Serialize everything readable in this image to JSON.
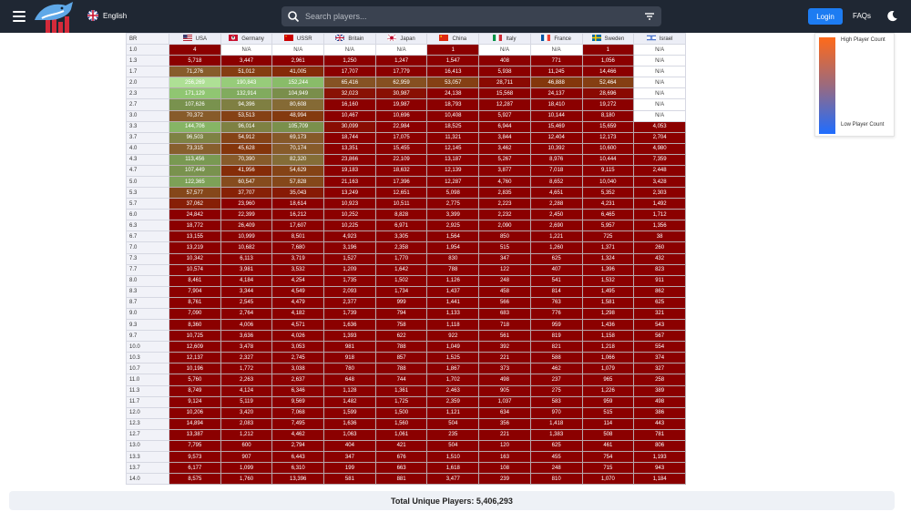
{
  "header": {
    "language": "English",
    "search_placeholder": "Search players...",
    "login_label": "Login",
    "faqs_label": "FAQs",
    "menu_icon": "hamburger-menu-icon",
    "search_icon": "search-icon",
    "filter_icon": "filter-icon",
    "theme_icon": "moon-icon"
  },
  "legend": {
    "high_label": "High Player Count",
    "low_label": "Low Player Count",
    "high_color": "#ff6a1a",
    "low_color": "#1f6dff"
  },
  "table": {
    "br_header": "BR",
    "nations": [
      {
        "name": "USA",
        "flag": "us"
      },
      {
        "name": "Germany",
        "flag": "de"
      },
      {
        "name": "USSR",
        "flag": "su"
      },
      {
        "name": "Britain",
        "flag": "gb"
      },
      {
        "name": "Japan",
        "flag": "jp"
      },
      {
        "name": "China",
        "flag": "cn"
      },
      {
        "name": "Italy",
        "flag": "it"
      },
      {
        "name": "France",
        "flag": "fr"
      },
      {
        "name": "Sweden",
        "flag": "se"
      },
      {
        "name": "Israel",
        "flag": "il"
      }
    ],
    "rows": [
      {
        "br": "1.0",
        "v": [
          "4",
          "N/A",
          "N/A",
          "N/A",
          "N/A",
          "1",
          "N/A",
          "N/A",
          "1",
          "N/A"
        ]
      },
      {
        "br": "1.3",
        "v": [
          "5,718",
          "3,447",
          "2,961",
          "1,250",
          "1,247",
          "1,547",
          "408",
          "771",
          "1,056",
          "N/A"
        ]
      },
      {
        "br": "1.7",
        "v": [
          "71,276",
          "51,012",
          "41,005",
          "17,707",
          "17,779",
          "16,413",
          "5,938",
          "11,245",
          "14,466",
          "N/A"
        ]
      },
      {
        "br": "2.0",
        "v": [
          "256,269",
          "190,843",
          "152,244",
          "65,416",
          "62,959",
          "53,057",
          "28,711",
          "46,888",
          "52,464",
          "N/A"
        ]
      },
      {
        "br": "2.3",
        "v": [
          "171,129",
          "132,914",
          "104,949",
          "32,023",
          "30,987",
          "24,138",
          "15,568",
          "24,137",
          "28,696",
          "N/A"
        ]
      },
      {
        "br": "2.7",
        "v": [
          "107,626",
          "94,396",
          "80,608",
          "16,160",
          "19,987",
          "18,793",
          "12,287",
          "18,410",
          "19,272",
          "N/A"
        ]
      },
      {
        "br": "3.0",
        "v": [
          "70,372",
          "53,513",
          "48,994",
          "10,467",
          "10,696",
          "10,408",
          "5,927",
          "10,144",
          "8,180",
          "N/A"
        ]
      },
      {
        "br": "3.3",
        "v": [
          "144,706",
          "96,014",
          "105,709",
          "30,099",
          "22,984",
          "18,525",
          "6,944",
          "15,469",
          "15,659",
          "4,053"
        ]
      },
      {
        "br": "3.7",
        "v": [
          "96,503",
          "54,912",
          "69,173",
          "18,744",
          "17,075",
          "11,321",
          "3,844",
          "12,404",
          "12,173",
          "2,704"
        ]
      },
      {
        "br": "4.0",
        "v": [
          "73,315",
          "45,628",
          "70,174",
          "13,351",
          "15,455",
          "12,145",
          "3,462",
          "10,392",
          "10,600",
          "4,980"
        ]
      },
      {
        "br": "4.3",
        "v": [
          "113,456",
          "70,390",
          "82,320",
          "23,866",
          "22,109",
          "13,187",
          "5,267",
          "8,976",
          "10,444",
          "7,359"
        ]
      },
      {
        "br": "4.7",
        "v": [
          "107,449",
          "41,956",
          "54,629",
          "19,183",
          "18,632",
          "12,139",
          "3,877",
          "7,018",
          "9,115",
          "2,448"
        ]
      },
      {
        "br": "5.0",
        "v": [
          "122,365",
          "60,547",
          "57,828",
          "21,163",
          "17,396",
          "12,287",
          "4,760",
          "8,652",
          "10,040",
          "3,428"
        ]
      },
      {
        "br": "5.3",
        "v": [
          "57,577",
          "37,707",
          "35,043",
          "13,249",
          "12,651",
          "5,098",
          "2,835",
          "4,651",
          "5,352",
          "2,303"
        ]
      },
      {
        "br": "5.7",
        "v": [
          "37,062",
          "23,960",
          "18,614",
          "10,923",
          "10,511",
          "2,775",
          "2,223",
          "2,288",
          "4,231",
          "1,492"
        ]
      },
      {
        "br": "6.0",
        "v": [
          "24,842",
          "22,399",
          "16,212",
          "10,252",
          "8,828",
          "3,399",
          "2,232",
          "2,450",
          "6,465",
          "1,712"
        ]
      },
      {
        "br": "6.3",
        "v": [
          "18,772",
          "26,409",
          "17,607",
          "10,225",
          "6,971",
          "2,925",
          "2,090",
          "2,690",
          "5,957",
          "1,356"
        ]
      },
      {
        "br": "6.7",
        "v": [
          "13,155",
          "10,999",
          "8,501",
          "4,923",
          "3,305",
          "1,564",
          "850",
          "1,221",
          "725",
          "38"
        ]
      },
      {
        "br": "7.0",
        "v": [
          "13,219",
          "10,682",
          "7,680",
          "3,196",
          "2,358",
          "1,954",
          "515",
          "1,260",
          "1,371",
          "260"
        ]
      },
      {
        "br": "7.3",
        "v": [
          "10,342",
          "6,113",
          "3,719",
          "1,527",
          "1,770",
          "830",
          "347",
          "625",
          "1,324",
          "432"
        ]
      },
      {
        "br": "7.7",
        "v": [
          "10,574",
          "3,981",
          "3,532",
          "1,209",
          "1,642",
          "788",
          "122",
          "407",
          "1,396",
          "823"
        ]
      },
      {
        "br": "8.0",
        "v": [
          "8,461",
          "4,184",
          "4,254",
          "1,735",
          "1,502",
          "1,126",
          "248",
          "541",
          "1,532",
          "911"
        ]
      },
      {
        "br": "8.3",
        "v": [
          "7,904",
          "3,344",
          "4,549",
          "2,093",
          "1,734",
          "1,437",
          "458",
          "814",
          "1,495",
          "862"
        ]
      },
      {
        "br": "8.7",
        "v": [
          "8,761",
          "2,545",
          "4,479",
          "2,377",
          "999",
          "1,441",
          "566",
          "763",
          "1,581",
          "625"
        ]
      },
      {
        "br": "9.0",
        "v": [
          "7,090",
          "2,764",
          "4,182",
          "1,739",
          "794",
          "1,133",
          "683",
          "776",
          "1,298",
          "321"
        ]
      },
      {
        "br": "9.3",
        "v": [
          "8,360",
          "4,006",
          "4,571",
          "1,636",
          "758",
          "1,118",
          "718",
          "959",
          "1,436",
          "543"
        ]
      },
      {
        "br": "9.7",
        "v": [
          "10,725",
          "3,636",
          "4,026",
          "1,393",
          "622",
          "922",
          "561",
          "819",
          "1,158",
          "567"
        ]
      },
      {
        "br": "10.0",
        "v": [
          "12,609",
          "3,478",
          "3,053",
          "981",
          "788",
          "1,049",
          "392",
          "821",
          "1,218",
          "554"
        ]
      },
      {
        "br": "10.3",
        "v": [
          "12,137",
          "2,327",
          "2,745",
          "918",
          "857",
          "1,525",
          "221",
          "588",
          "1,066",
          "374"
        ]
      },
      {
        "br": "10.7",
        "v": [
          "10,196",
          "1,772",
          "3,038",
          "780",
          "788",
          "1,867",
          "373",
          "462",
          "1,079",
          "327"
        ]
      },
      {
        "br": "11.0",
        "v": [
          "5,760",
          "2,263",
          "2,637",
          "648",
          "744",
          "1,702",
          "498",
          "237",
          "965",
          "258"
        ]
      },
      {
        "br": "11.3",
        "v": [
          "8,749",
          "4,124",
          "6,346",
          "1,128",
          "1,361",
          "2,463",
          "905",
          "275",
          "1,226",
          "389"
        ]
      },
      {
        "br": "11.7",
        "v": [
          "9,124",
          "5,119",
          "9,569",
          "1,482",
          "1,725",
          "2,359",
          "1,037",
          "583",
          "959",
          "498"
        ]
      },
      {
        "br": "12.0",
        "v": [
          "10,206",
          "3,420",
          "7,068",
          "1,599",
          "1,500",
          "1,121",
          "634",
          "970",
          "515",
          "386"
        ]
      },
      {
        "br": "12.3",
        "v": [
          "14,894",
          "2,083",
          "7,495",
          "1,636",
          "1,560",
          "504",
          "356",
          "1,418",
          "114",
          "443"
        ]
      },
      {
        "br": "12.7",
        "v": [
          "13,387",
          "1,212",
          "4,462",
          "1,063",
          "1,061",
          "235",
          "221",
          "1,383",
          "508",
          "781"
        ]
      },
      {
        "br": "13.0",
        "v": [
          "7,795",
          "600",
          "2,794",
          "404",
          "421",
          "504",
          "120",
          "625",
          "461",
          "806"
        ]
      },
      {
        "br": "13.3",
        "v": [
          "9,573",
          "907",
          "6,443",
          "347",
          "676",
          "1,510",
          "163",
          "455",
          "754",
          "1,193"
        ]
      },
      {
        "br": "13.7",
        "v": [
          "6,177",
          "1,099",
          "6,310",
          "199",
          "663",
          "1,618",
          "108",
          "248",
          "715",
          "943"
        ]
      },
      {
        "br": "14.0",
        "v": [
          "8,575",
          "1,760",
          "13,396",
          "581",
          "881",
          "3,477",
          "239",
          "810",
          "1,070",
          "1,184"
        ]
      }
    ]
  },
  "footer": {
    "total_label": "Total Unique Players: 5,406,293"
  }
}
